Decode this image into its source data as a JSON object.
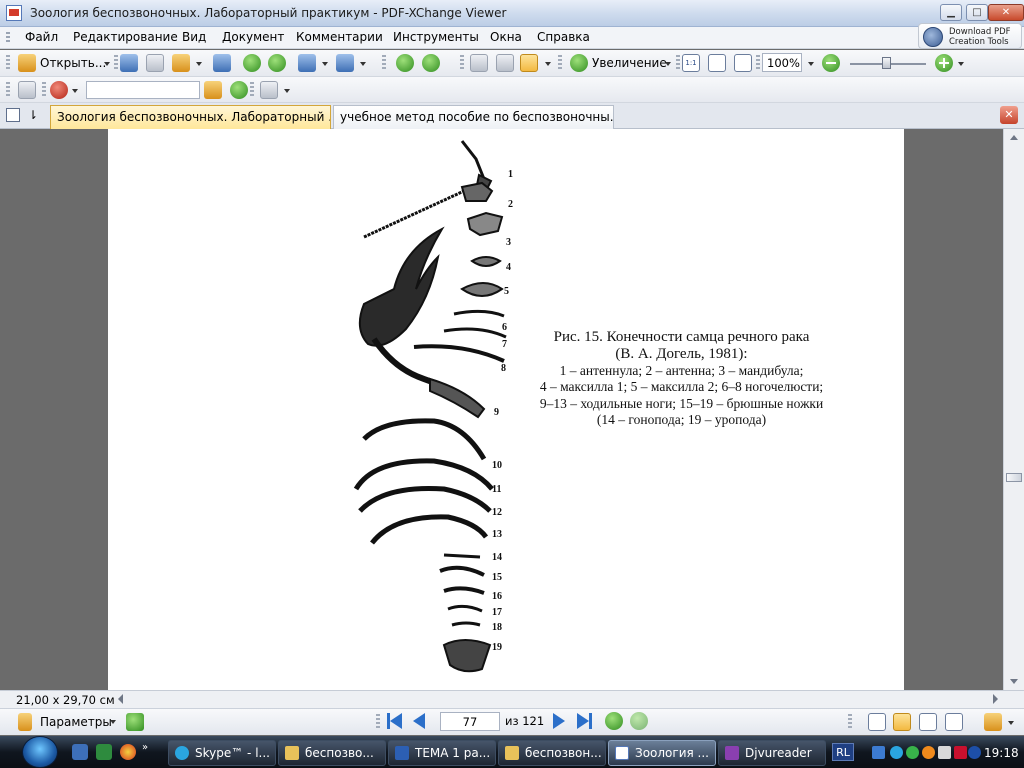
{
  "window": {
    "title": "Зоология беспозвоночных. Лабораторный практикум - PDF-XChange Viewer",
    "buttons": {
      "minimize": "▁",
      "maximize": "□",
      "close": "✕"
    }
  },
  "menu": {
    "items": [
      "Файл",
      "Редактирование",
      "Вид",
      "Документ",
      "Комментарии",
      "Инструменты",
      "Окна",
      "Справка"
    ]
  },
  "promo": {
    "line1": "Download PDF",
    "line2": "Creation Tools"
  },
  "toolbar": {
    "open_label": "Открыть...",
    "zoom_label": "Увеличение",
    "zoom_value": "100%",
    "actual_size": "1:1"
  },
  "tabs": [
    {
      "label": "Зоология беспозвоночных. Лабораторный ...",
      "active": true
    },
    {
      "label": "учебное метод пособие по беспозвоночны...",
      "active": false
    }
  ],
  "document": {
    "caption": {
      "title": "Рис. 15. Конечности самца речного рака",
      "source": "(В.  А. Догель, 1981):",
      "lines": [
        "1 – антеннула; 2 – антенна; 3 – мандибула;",
        "4 – максилла 1; 5 – максилла 2; 6–8 ногочелюсти;",
        "9–13 – ходильные ноги; 15–19 – брюшные ножки",
        "(14 – гонопода; 19 – уропода)"
      ]
    },
    "limb_numbers": [
      "1",
      "2",
      "3",
      "4",
      "5",
      "6",
      "7",
      "8",
      "9",
      "10",
      "11",
      "12",
      "13",
      "14",
      "15",
      "16",
      "17",
      "18",
      "19"
    ]
  },
  "status": {
    "page_size": "21,00 x 29,70 см"
  },
  "navigation": {
    "params_label": "Параметры",
    "current_page": "77",
    "of_label": "из 121"
  },
  "taskbar": {
    "buttons": [
      {
        "label": "Skype™ - l...",
        "current": false
      },
      {
        "label": "беспозво...",
        "current": false
      },
      {
        "label": "ТЕМА 1 ра...",
        "current": false
      },
      {
        "label": "беспозвон...",
        "current": false
      },
      {
        "label": "Зоология ...",
        "current": true
      },
      {
        "label": "Djvureader",
        "current": false
      }
    ],
    "language": "RL",
    "clock": "19:18"
  }
}
